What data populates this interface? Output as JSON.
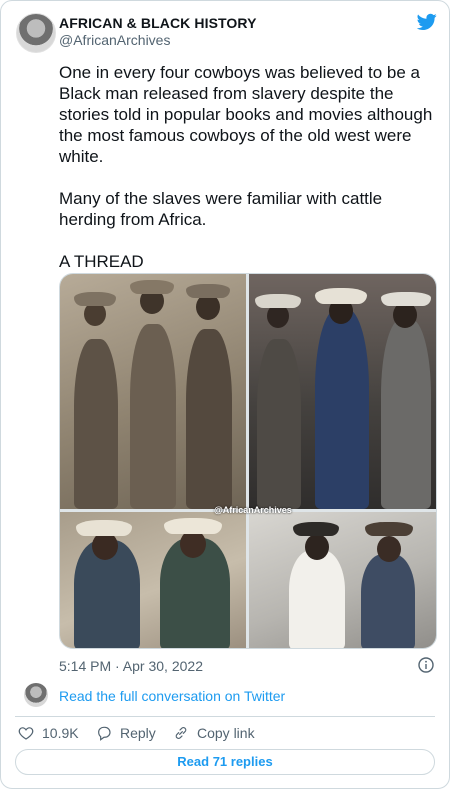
{
  "author": {
    "name": "AFRICAN & BLACK HISTORY",
    "handle": "@AfricanArchives"
  },
  "tweet": {
    "text": "One in every four cowboys was believed to be a Black man released from slavery despite the stories told in popular books and movies although the most famous cowboys of the old west were white.\n\nMany of the slaves were familiar with cattle herding from Africa.\n\nA THREAD",
    "watermark": "@AfricanArchives",
    "timestamp": "5:14 PM · Apr 30, 2022"
  },
  "conversation": {
    "link_text": "Read the full conversation on Twitter"
  },
  "actions": {
    "like_count": "10.9K",
    "reply_label": "Reply",
    "copy_label": "Copy link"
  },
  "read_replies_label": "Read 71 replies",
  "colors": {
    "accent": "#1d9bf0",
    "muted_text": "#536471",
    "border": "#cfd9de"
  },
  "icons": [
    "twitter-bird-icon",
    "info-icon",
    "heart-icon",
    "reply-icon",
    "link-icon"
  ]
}
